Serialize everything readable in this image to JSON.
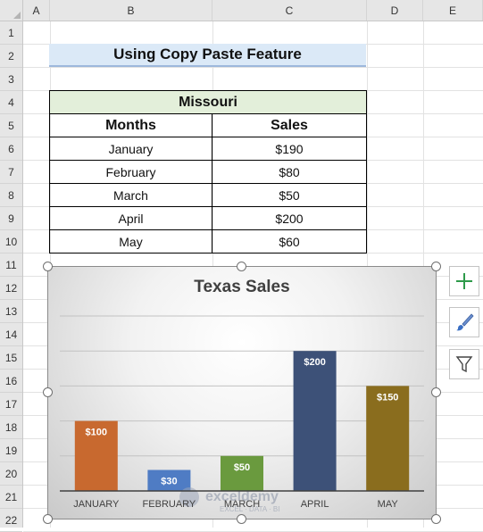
{
  "columns": [
    "A",
    "B",
    "C",
    "D",
    "E"
  ],
  "rows": [
    "1",
    "2",
    "3",
    "4",
    "5",
    "6",
    "7",
    "8",
    "9",
    "10",
    "11",
    "12",
    "13",
    "14",
    "15",
    "16",
    "17",
    "18",
    "19",
    "20",
    "21",
    "22"
  ],
  "title": "Using Copy Paste Feature",
  "table": {
    "state": "Missouri",
    "headers": {
      "months": "Months",
      "sales": "Sales"
    },
    "rows": [
      {
        "month": "January",
        "sales": "$190"
      },
      {
        "month": "February",
        "sales": "$80"
      },
      {
        "month": "March",
        "sales": "$50"
      },
      {
        "month": "April",
        "sales": "$200"
      },
      {
        "month": "May",
        "sales": "$60"
      }
    ]
  },
  "chart_data": {
    "type": "bar",
    "title": "Texas Sales",
    "categories": [
      "JANUARY",
      "FEBRUARY",
      "MARCH",
      "APRIL",
      "MAY"
    ],
    "values": [
      100,
      30,
      50,
      200,
      150
    ],
    "data_labels": [
      "$100",
      "$30",
      "$50",
      "$200",
      "$150"
    ],
    "colors": [
      "#c8692f",
      "#4f7cc4",
      "#6a9a3e",
      "#3d5178",
      "#8a6d1e"
    ],
    "ylim": [
      0,
      250
    ],
    "grid": true,
    "legend": "none"
  },
  "watermark": {
    "name": "exceldemy",
    "tagline": "EXCEL · DATA · BI"
  },
  "side_buttons": [
    {
      "icon": "plus-icon"
    },
    {
      "icon": "brush-icon"
    },
    {
      "icon": "filter-icon"
    }
  ]
}
